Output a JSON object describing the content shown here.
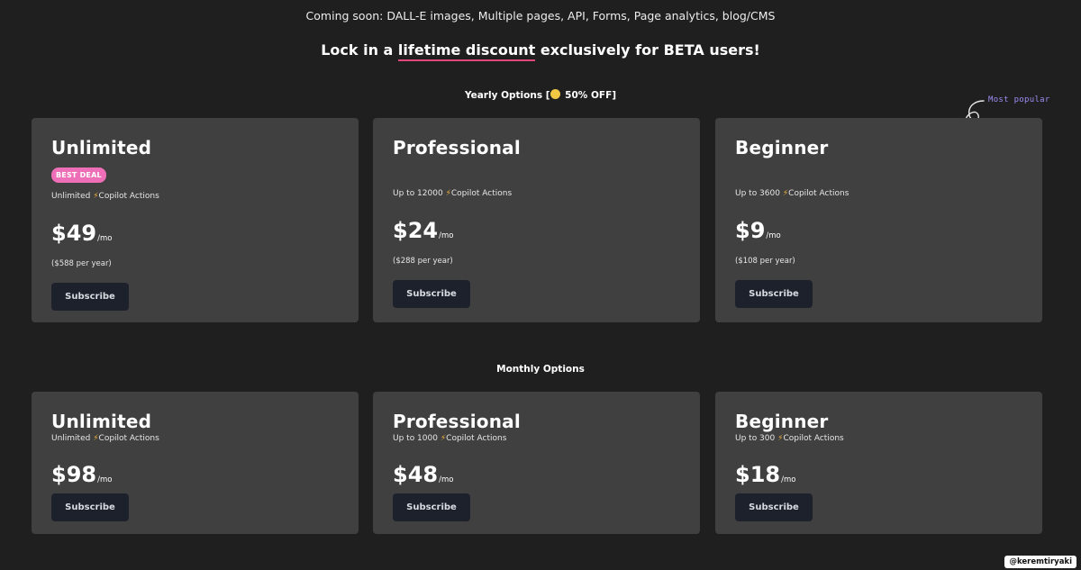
{
  "banner": {
    "coming_soon": "Coming soon: DALL-E images, Multiple pages, API, Forms, Page analytics, blog/CMS",
    "headline_pre": "Lock in a ",
    "headline_highlight": "lifetime discount",
    "headline_post": " exclusively for BETA users!"
  },
  "yearly": {
    "label": "Yearly Options [",
    "label_suffix": " 50% OFF]",
    "emoji_icon": "money-face-emoji-icon",
    "most_popular": "Most popular",
    "cards": [
      {
        "title": "Unlimited",
        "badge": "BEST DEAL",
        "actions_prefix": "Unlimited ",
        "actions_suffix": "Copilot Actions",
        "price": "$49",
        "per": "/mo",
        "per_year": "($588 per year)",
        "button": "Subscribe"
      },
      {
        "title": "Professional",
        "actions_prefix": "Up to 12000 ",
        "actions_suffix": "Copilot Actions",
        "price": "$24",
        "per": "/mo",
        "per_year": "($288 per year)",
        "button": "Subscribe"
      },
      {
        "title": "Beginner",
        "actions_prefix": "Up to 3600 ",
        "actions_suffix": "Copilot Actions",
        "price": "$9",
        "per": "/mo",
        "per_year": "($108 per year)",
        "button": "Subscribe"
      }
    ]
  },
  "monthly": {
    "label": "Monthly Options",
    "cards": [
      {
        "title": "Unlimited",
        "actions_prefix": "Unlimited ",
        "actions_suffix": "Copilot Actions",
        "price": "$98",
        "per": "/mo",
        "button": "Subscribe"
      },
      {
        "title": "Professional",
        "actions_prefix": "Up to 1000 ",
        "actions_suffix": "Copilot Actions",
        "price": "$48",
        "per": "/mo",
        "button": "Subscribe"
      },
      {
        "title": "Beginner",
        "actions_prefix": "Up to 300 ",
        "actions_suffix": "Copilot Actions",
        "price": "$18",
        "per": "/mo",
        "button": "Subscribe"
      }
    ]
  },
  "watermark": "@keremtiryaki",
  "colors": {
    "background": "#1f1f1f",
    "card": "#404040",
    "badge": "#ee6fb7",
    "highlight_underline": "#e0457b",
    "button": "#1d212b",
    "most_popular": "#9d8cf2",
    "bolt": "#f3b53c"
  }
}
